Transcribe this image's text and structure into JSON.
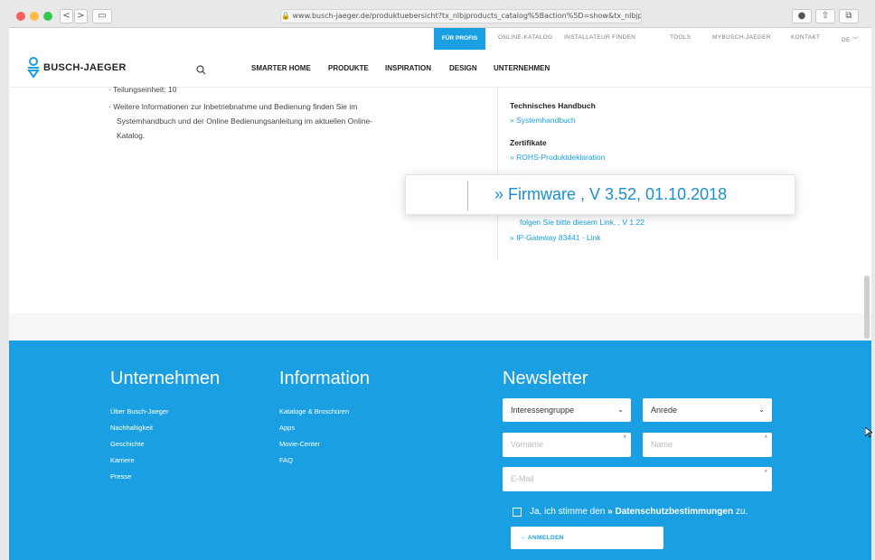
{
  "browser": {
    "url": "www.busch-jaeger.de/produktuebersicht?tx_nlbjproducts_catalog%5Baction%5D=show&tx_nlbjp",
    "back": "<",
    "forward": ">"
  },
  "header": {
    "top_nav": [
      "FÜR PROFIS",
      "ONLINE-KATALOG",
      "INSTALLATEUR FINDEN",
      "TOOLS",
      "MYBUSCH-JAEGER",
      "KONTAKT",
      "DE"
    ],
    "logo_text": "BUSCH-JAEGER",
    "main_nav": [
      "SMARTER HOME",
      "PRODUKTE",
      "INSPIRATION",
      "DESIGN",
      "UNTERNEHMEN"
    ]
  },
  "content": {
    "bullet_1": "· Teilungseinheit: 10",
    "bullet_2_line1": "· Weitere Informationen zur Inbetriebnahme und Bedienung finden Sie im",
    "bullet_2_line2": "Systemhandbuch und der Online Bedienungsanleitung im aktuellen Online-",
    "bullet_2_line3": "Katalog.",
    "tech_head": "Technisches Handbuch",
    "tech_link": "» Systemhandbuch",
    "cert_head": "Zertifikate",
    "cert_link": "» ROHS-Produktdeklaration",
    "firmware_callout": "» Firmware , V 3.52, 01.10.2018",
    "link_follow": "folgen Sie bitte diesem Link. , V 1.22",
    "link_gateway": "» IP-Gateway 83441 - Link"
  },
  "footer": {
    "col1_title": "Unternehmen",
    "col1_links": [
      "Über Busch-Jaeger",
      "Nachhaltigkeit",
      "Geschichte",
      "Karriere",
      "Presse"
    ],
    "col2_title": "Information",
    "col2_links": [
      "Kataloge & Broschüren",
      "Apps",
      "Movie-Center",
      "FAQ"
    ],
    "newsletter_title": "Newsletter",
    "select_group": "Interessengruppe",
    "select_salutation": "Anrede",
    "firstname_placeholder": "Vorname",
    "lastname_placeholder": "Name",
    "email_placeholder": "E-Mail",
    "consent_pre": "Ja, ich stimme den ",
    "consent_link": "» Datenschutzbestimmungen",
    "consent_post": " zu.",
    "submit_label": "→  ANMELDEN"
  },
  "colors": {
    "accent": "#1aa0e2",
    "text": "#222222"
  }
}
